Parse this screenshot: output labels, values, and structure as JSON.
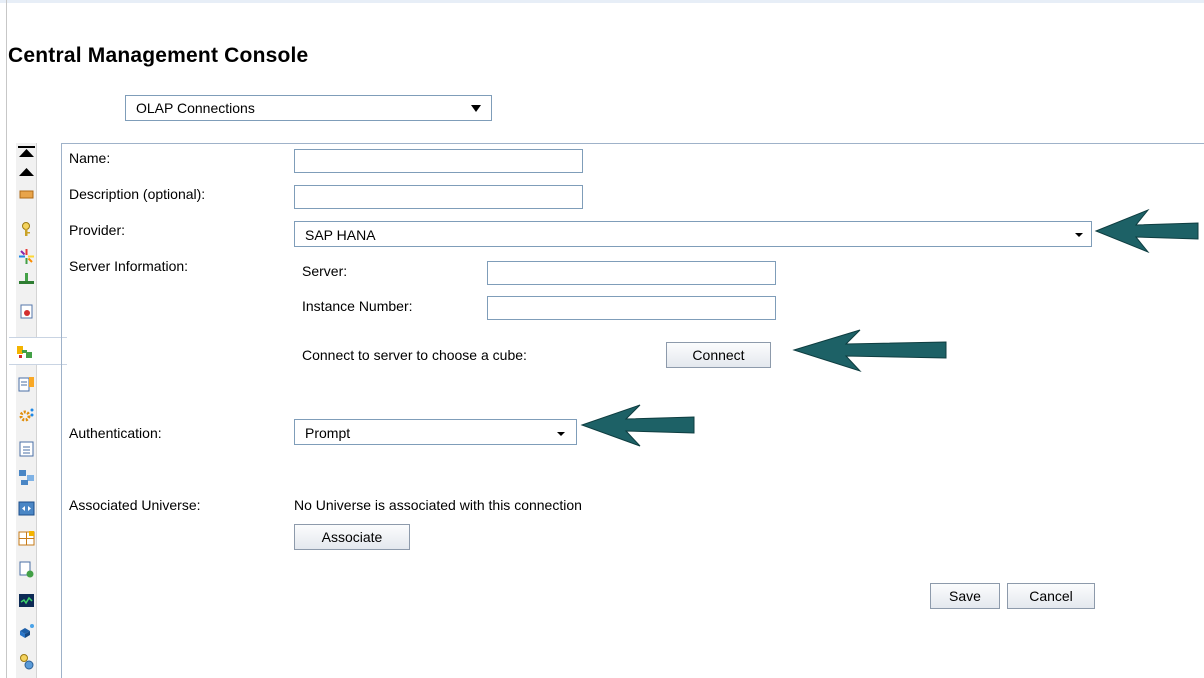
{
  "app": {
    "title": "Central Management Console"
  },
  "view_selector": {
    "value": "OLAP Connections"
  },
  "form": {
    "name_label": "Name:",
    "description_label": "Description (optional):",
    "provider_label": "Provider:",
    "provider_value": "SAP HANA",
    "server_info_label": "Server Information:",
    "server_label": "Server:",
    "instance_label": "Instance Number:",
    "connect_prompt": "Connect to server to choose a cube:",
    "connect_button": "Connect",
    "authentication_label": "Authentication:",
    "authentication_value": "Prompt",
    "universe_label": "Associated Universe:",
    "universe_value": "No Universe is associated with this connection",
    "associate_button": "Associate",
    "save_button": "Save",
    "cancel_button": "Cancel"
  },
  "toolbar_icons": [
    "nav-first-icon",
    "nav-up-icon",
    "folder-icon",
    "key-icon",
    "star-burst-icon",
    "network-icon",
    "document-arrow-icon",
    "connection-icon",
    "properties-icon",
    "settings-icon",
    "clipboard-icon",
    "workflow-icon",
    "split-view-icon",
    "grid-add-icon",
    "document-check-icon",
    "monitor-icon",
    "cubes-icon",
    "key-gear-icon"
  ],
  "colors": {
    "arrow": "#1d6166",
    "border": "#7f9db9"
  }
}
